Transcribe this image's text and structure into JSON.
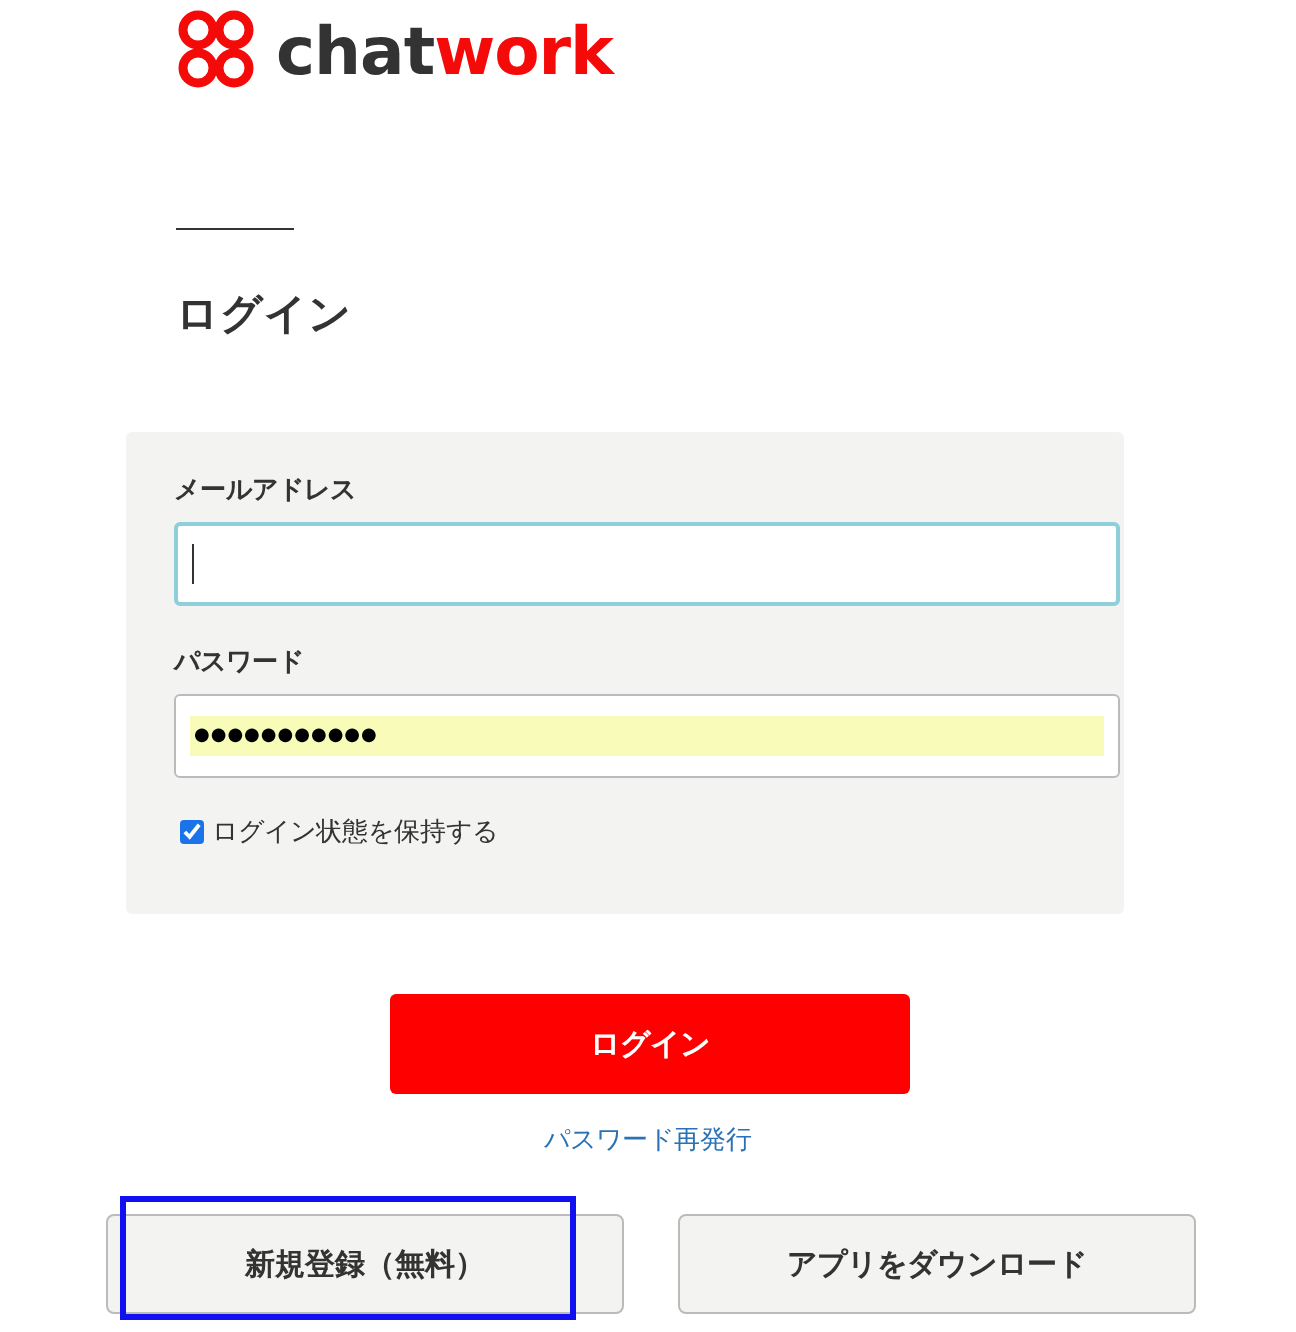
{
  "logo": {
    "parts": [
      {
        "text": "chat",
        "kind": "dark"
      },
      {
        "text": "work",
        "kind": "accent"
      }
    ]
  },
  "heading": "ログイン",
  "form": {
    "email": {
      "label": "メールアドレス",
      "focused": true
    },
    "password": {
      "label": "パスワード",
      "value": "●●●●●●●●●●●",
      "autofilled": true
    },
    "remember": {
      "label": "ログイン状態を保持する",
      "checked": true
    }
  },
  "login_button": "ログイン",
  "reset_link": "パスワード再発行",
  "buttons": [
    {
      "label": "新規登録（無料）",
      "highlighted": true
    },
    {
      "label": "アプリをダウンロード",
      "highlighted": false
    }
  ]
}
